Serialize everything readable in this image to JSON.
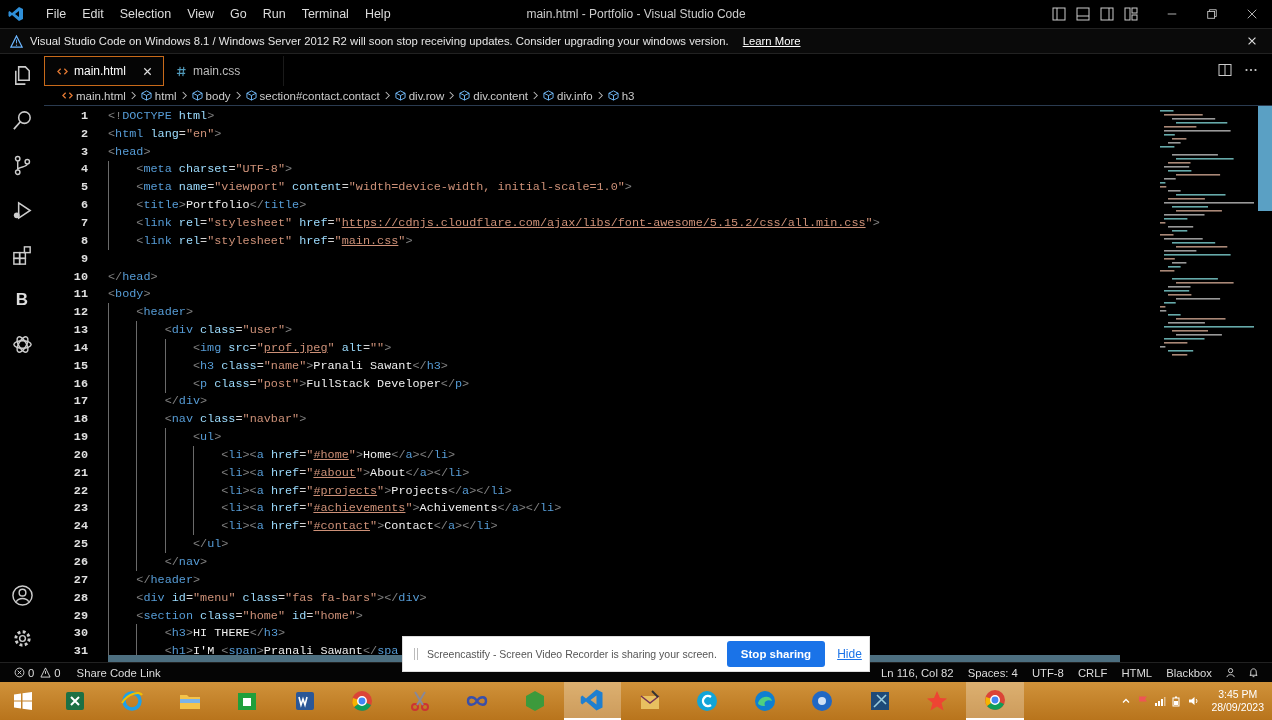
{
  "window": {
    "title": "main.html - Portfolio - Visual Studio Code"
  },
  "menu": [
    "File",
    "Edit",
    "Selection",
    "View",
    "Go",
    "Run",
    "Terminal",
    "Help"
  ],
  "banner": {
    "message": "Visual Studio Code on Windows 8.1 / Windows Server 2012 R2 will soon stop receiving updates. Consider upgrading your windows version.",
    "link": "Learn More"
  },
  "activity_bar": [
    {
      "kind": "explorer"
    },
    {
      "kind": "search"
    },
    {
      "kind": "source-control"
    },
    {
      "kind": "run"
    },
    {
      "kind": "extensions"
    },
    {
      "kind": "letter",
      "label": "B"
    },
    {
      "kind": "knot"
    }
  ],
  "activity_bar_bottom": [
    {
      "kind": "account"
    },
    {
      "kind": "settings"
    }
  ],
  "tabs": [
    {
      "label": "main.html",
      "kind": "html",
      "selected": true
    },
    {
      "label": "main.css",
      "kind": "css",
      "selected": false
    }
  ],
  "breadcrumb": [
    {
      "label": "main.html",
      "kind": "file"
    },
    {
      "label": "html",
      "kind": "element"
    },
    {
      "label": "body",
      "kind": "element"
    },
    {
      "label": "section#contact.contact",
      "kind": "element"
    },
    {
      "label": "div.row",
      "kind": "element"
    },
    {
      "label": "div.content",
      "kind": "element"
    },
    {
      "label": "div.info",
      "kind": "element"
    },
    {
      "label": "h3",
      "kind": "element"
    }
  ],
  "lines": [
    {
      "number": "1",
      "tokens": [
        {
          "kind": "punct",
          "text": "<!"
        },
        {
          "kind": "tag",
          "text": "DOCTYPE"
        },
        {
          "kind": "attr",
          "text": " html"
        },
        {
          "kind": "punct",
          "text": ">"
        }
      ]
    },
    {
      "number": "2",
      "tokens": [
        {
          "kind": "punct",
          "text": "<"
        },
        {
          "kind": "tag",
          "text": "html"
        },
        {
          "kind": "attr",
          "text": " lang"
        },
        {
          "kind": "eq",
          "text": "="
        },
        {
          "kind": "str",
          "text": "\"en\""
        },
        {
          "kind": "punct",
          "text": ">"
        }
      ]
    },
    {
      "number": "3",
      "tokens": [
        {
          "kind": "punct",
          "text": "<"
        },
        {
          "kind": "tag",
          "text": "head"
        },
        {
          "kind": "punct",
          "text": ">"
        }
      ]
    },
    {
      "number": "4",
      "tokens": [
        {
          "kind": "punct",
          "text": "    <"
        },
        {
          "kind": "tag",
          "text": "meta"
        },
        {
          "kind": "attr",
          "text": " charset"
        },
        {
          "kind": "eq",
          "text": "="
        },
        {
          "kind": "str",
          "text": "\"UTF-8\""
        },
        {
          "kind": "punct",
          "text": ">"
        }
      ]
    },
    {
      "number": "5",
      "tokens": [
        {
          "kind": "punct",
          "text": "    <"
        },
        {
          "kind": "tag",
          "text": "meta"
        },
        {
          "kind": "attr",
          "text": " name"
        },
        {
          "kind": "eq",
          "text": "="
        },
        {
          "kind": "str",
          "text": "\"viewport\""
        },
        {
          "kind": "attr",
          "text": " content"
        },
        {
          "kind": "eq",
          "text": "="
        },
        {
          "kind": "str",
          "text": "\"width=device-width, initial-scale=1.0\""
        },
        {
          "kind": "punct",
          "text": ">"
        }
      ]
    },
    {
      "number": "6",
      "tokens": [
        {
          "kind": "punct",
          "text": "    <"
        },
        {
          "kind": "tag",
          "text": "title"
        },
        {
          "kind": "punct",
          "text": ">"
        },
        {
          "kind": "text",
          "text": "Portfolio"
        },
        {
          "kind": "punct",
          "text": "</"
        },
        {
          "kind": "tag",
          "text": "title"
        },
        {
          "kind": "punct",
          "text": ">"
        }
      ]
    },
    {
      "number": "7",
      "tokens": [
        {
          "kind": "punct",
          "text": "    <"
        },
        {
          "kind": "tag",
          "text": "link"
        },
        {
          "kind": "attr",
          "text": " rel"
        },
        {
          "kind": "eq",
          "text": "="
        },
        {
          "kind": "str",
          "text": "\"stylesheet\""
        },
        {
          "kind": "attr",
          "text": " href"
        },
        {
          "kind": "eq",
          "text": "="
        },
        {
          "kind": "str",
          "text": "\""
        },
        {
          "kind": "link",
          "text": "https://cdnjs.cloudflare.com/ajax/libs/font-awesome/5.15.2/css/all.min.css"
        },
        {
          "kind": "str",
          "text": "\""
        },
        {
          "kind": "punct",
          "text": ">"
        }
      ]
    },
    {
      "number": "8",
      "tokens": [
        {
          "kind": "punct",
          "text": "    <"
        },
        {
          "kind": "tag",
          "text": "link"
        },
        {
          "kind": "attr",
          "text": " rel"
        },
        {
          "kind": "eq",
          "text": "="
        },
        {
          "kind": "str",
          "text": "\"stylesheet\""
        },
        {
          "kind": "attr",
          "text": " href"
        },
        {
          "kind": "eq",
          "text": "="
        },
        {
          "kind": "str",
          "text": "\""
        },
        {
          "kind": "link",
          "text": "main.css"
        },
        {
          "kind": "str",
          "text": "\""
        },
        {
          "kind": "punct",
          "text": ">"
        }
      ]
    },
    {
      "number": "9"
    },
    {
      "number": "10",
      "tokens": [
        {
          "kind": "punct",
          "text": "</"
        },
        {
          "kind": "tag",
          "text": "head"
        },
        {
          "kind": "punct",
          "text": ">"
        }
      ]
    },
    {
      "number": "11",
      "tokens": [
        {
          "kind": "punct",
          "text": "<"
        },
        {
          "kind": "tag",
          "text": "body"
        },
        {
          "kind": "punct",
          "text": ">"
        }
      ]
    },
    {
      "number": "12",
      "tokens": [
        {
          "kind": "punct",
          "text": "    <"
        },
        {
          "kind": "tag",
          "text": "header"
        },
        {
          "kind": "punct",
          "text": ">"
        }
      ]
    },
    {
      "number": "13",
      "tokens": [
        {
          "kind": "punct",
          "text": "        <"
        },
        {
          "kind": "tag",
          "text": "div"
        },
        {
          "kind": "attr",
          "text": " class"
        },
        {
          "kind": "eq",
          "text": "="
        },
        {
          "kind": "str",
          "text": "\"user\""
        },
        {
          "kind": "punct",
          "text": ">"
        }
      ]
    },
    {
      "number": "14",
      "tokens": [
        {
          "kind": "punct",
          "text": "            <"
        },
        {
          "kind": "tag",
          "text": "img"
        },
        {
          "kind": "attr",
          "text": " src"
        },
        {
          "kind": "eq",
          "text": "="
        },
        {
          "kind": "str",
          "text": "\""
        },
        {
          "kind": "link",
          "text": "prof.jpeg"
        },
        {
          "kind": "str",
          "text": "\""
        },
        {
          "kind": "attr",
          "text": " alt"
        },
        {
          "kind": "eq",
          "text": "="
        },
        {
          "kind": "str",
          "text": "\"\""
        },
        {
          "kind": "punct",
          "text": ">"
        }
      ]
    },
    {
      "number": "15",
      "tokens": [
        {
          "kind": "punct",
          "text": "            <"
        },
        {
          "kind": "tag",
          "text": "h3"
        },
        {
          "kind": "attr",
          "text": " class"
        },
        {
          "kind": "eq",
          "text": "="
        },
        {
          "kind": "str",
          "text": "\"name\""
        },
        {
          "kind": "punct",
          "text": ">"
        },
        {
          "kind": "text",
          "text": "Pranali Sawant"
        },
        {
          "kind": "punct",
          "text": "</"
        },
        {
          "kind": "tag",
          "text": "h3"
        },
        {
          "kind": "punct",
          "text": ">"
        }
      ]
    },
    {
      "number": "16",
      "tokens": [
        {
          "kind": "punct",
          "text": "            <"
        },
        {
          "kind": "tag",
          "text": "p"
        },
        {
          "kind": "attr",
          "text": " class"
        },
        {
          "kind": "eq",
          "text": "="
        },
        {
          "kind": "str",
          "text": "\"post\""
        },
        {
          "kind": "punct",
          "text": ">"
        },
        {
          "kind": "text",
          "text": "FullStack Developer"
        },
        {
          "kind": "punct",
          "text": "</"
        },
        {
          "kind": "tag",
          "text": "p"
        },
        {
          "kind": "punct",
          "text": ">"
        }
      ]
    },
    {
      "number": "17",
      "tokens": [
        {
          "kind": "punct",
          "text": "        </"
        },
        {
          "kind": "tag",
          "text": "div"
        },
        {
          "kind": "punct",
          "text": ">"
        }
      ]
    },
    {
      "number": "18",
      "tokens": [
        {
          "kind": "punct",
          "text": "        <"
        },
        {
          "kind": "tag",
          "text": "nav"
        },
        {
          "kind": "attr",
          "text": " class"
        },
        {
          "kind": "eq",
          "text": "="
        },
        {
          "kind": "str",
          "text": "\"navbar\""
        },
        {
          "kind": "punct",
          "text": ">"
        }
      ]
    },
    {
      "number": "19",
      "tokens": [
        {
          "kind": "punct",
          "text": "            <"
        },
        {
          "kind": "tag",
          "text": "ul"
        },
        {
          "kind": "punct",
          "text": ">"
        }
      ]
    },
    {
      "number": "20",
      "tokens": [
        {
          "kind": "punct",
          "text": "                <"
        },
        {
          "kind": "tag",
          "text": "li"
        },
        {
          "kind": "punct",
          "text": "><"
        },
        {
          "kind": "tag",
          "text": "a"
        },
        {
          "kind": "attr",
          "text": " href"
        },
        {
          "kind": "eq",
          "text": "="
        },
        {
          "kind": "str",
          "text": "\""
        },
        {
          "kind": "link",
          "text": "#home"
        },
        {
          "kind": "str",
          "text": "\""
        },
        {
          "kind": "punct",
          "text": ">"
        },
        {
          "kind": "text",
          "text": "Home"
        },
        {
          "kind": "punct",
          "text": "</"
        },
        {
          "kind": "tag",
          "text": "a"
        },
        {
          "kind": "punct",
          "text": "></"
        },
        {
          "kind": "tag",
          "text": "li"
        },
        {
          "kind": "punct",
          "text": ">"
        }
      ]
    },
    {
      "number": "21",
      "tokens": [
        {
          "kind": "punct",
          "text": "                <"
        },
        {
          "kind": "tag",
          "text": "li"
        },
        {
          "kind": "punct",
          "text": "><"
        },
        {
          "kind": "tag",
          "text": "a"
        },
        {
          "kind": "attr",
          "text": " href"
        },
        {
          "kind": "eq",
          "text": "="
        },
        {
          "kind": "str",
          "text": "\""
        },
        {
          "kind": "link",
          "text": "#about"
        },
        {
          "kind": "str",
          "text": "\""
        },
        {
          "kind": "punct",
          "text": ">"
        },
        {
          "kind": "text",
          "text": "About"
        },
        {
          "kind": "punct",
          "text": "</"
        },
        {
          "kind": "tag",
          "text": "a"
        },
        {
          "kind": "punct",
          "text": "></"
        },
        {
          "kind": "tag",
          "text": "li"
        },
        {
          "kind": "punct",
          "text": ">"
        }
      ]
    },
    {
      "number": "22",
      "tokens": [
        {
          "kind": "punct",
          "text": "                <"
        },
        {
          "kind": "tag",
          "text": "li"
        },
        {
          "kind": "punct",
          "text": "><"
        },
        {
          "kind": "tag",
          "text": "a"
        },
        {
          "kind": "attr",
          "text": " href"
        },
        {
          "kind": "eq",
          "text": "="
        },
        {
          "kind": "str",
          "text": "\""
        },
        {
          "kind": "link",
          "text": "#projects"
        },
        {
          "kind": "str",
          "text": "\""
        },
        {
          "kind": "punct",
          "text": ">"
        },
        {
          "kind": "text",
          "text": "Projects"
        },
        {
          "kind": "punct",
          "text": "</"
        },
        {
          "kind": "tag",
          "text": "a"
        },
        {
          "kind": "punct",
          "text": "></"
        },
        {
          "kind": "tag",
          "text": "li"
        },
        {
          "kind": "punct",
          "text": ">"
        }
      ]
    },
    {
      "number": "23",
      "tokens": [
        {
          "kind": "punct",
          "text": "                <"
        },
        {
          "kind": "tag",
          "text": "li"
        },
        {
          "kind": "punct",
          "text": "><"
        },
        {
          "kind": "tag",
          "text": "a"
        },
        {
          "kind": "attr",
          "text": " href"
        },
        {
          "kind": "eq",
          "text": "="
        },
        {
          "kind": "str",
          "text": "\""
        },
        {
          "kind": "link",
          "text": "#achievements"
        },
        {
          "kind": "str",
          "text": "\""
        },
        {
          "kind": "punct",
          "text": ">"
        },
        {
          "kind": "text",
          "text": "Achivements"
        },
        {
          "kind": "punct",
          "text": "</"
        },
        {
          "kind": "tag",
          "text": "a"
        },
        {
          "kind": "punct",
          "text": "></"
        },
        {
          "kind": "tag",
          "text": "li"
        },
        {
          "kind": "punct",
          "text": ">"
        }
      ]
    },
    {
      "number": "24",
      "tokens": [
        {
          "kind": "punct",
          "text": "                <"
        },
        {
          "kind": "tag",
          "text": "li"
        },
        {
          "kind": "punct",
          "text": "><"
        },
        {
          "kind": "tag",
          "text": "a"
        },
        {
          "kind": "attr",
          "text": " href"
        },
        {
          "kind": "eq",
          "text": "="
        },
        {
          "kind": "str",
          "text": "\""
        },
        {
          "kind": "link",
          "text": "#contact"
        },
        {
          "kind": "str",
          "text": "\""
        },
        {
          "kind": "punct",
          "text": ">"
        },
        {
          "kind": "text",
          "text": "Contact"
        },
        {
          "kind": "punct",
          "text": "</"
        },
        {
          "kind": "tag",
          "text": "a"
        },
        {
          "kind": "punct",
          "text": "></"
        },
        {
          "kind": "tag",
          "text": "li"
        },
        {
          "kind": "punct",
          "text": ">"
        }
      ]
    },
    {
      "number": "25",
      "tokens": [
        {
          "kind": "punct",
          "text": "            </"
        },
        {
          "kind": "tag",
          "text": "ul"
        },
        {
          "kind": "punct",
          "text": ">"
        }
      ]
    },
    {
      "number": "26",
      "tokens": [
        {
          "kind": "punct",
          "text": "        </"
        },
        {
          "kind": "tag",
          "text": "nav"
        },
        {
          "kind": "punct",
          "text": ">"
        }
      ]
    },
    {
      "number": "27",
      "tokens": [
        {
          "kind": "punct",
          "text": "    </"
        },
        {
          "kind": "tag",
          "text": "header"
        },
        {
          "kind": "punct",
          "text": ">"
        }
      ]
    },
    {
      "number": "28",
      "tokens": [
        {
          "kind": "punct",
          "text": "    <"
        },
        {
          "kind": "tag",
          "text": "div"
        },
        {
          "kind": "attr",
          "text": " id"
        },
        {
          "kind": "eq",
          "text": "="
        },
        {
          "kind": "str",
          "text": "\"menu\""
        },
        {
          "kind": "attr",
          "text": " class"
        },
        {
          "kind": "eq",
          "text": "="
        },
        {
          "kind": "str",
          "text": "\"fas fa-bars\""
        },
        {
          "kind": "punct",
          "text": "></"
        },
        {
          "kind": "tag",
          "text": "div"
        },
        {
          "kind": "punct",
          "text": ">"
        }
      ]
    },
    {
      "number": "29",
      "tokens": [
        {
          "kind": "punct",
          "text": "    <"
        },
        {
          "kind": "tag",
          "text": "section"
        },
        {
          "kind": "attr",
          "text": " class"
        },
        {
          "kind": "eq",
          "text": "="
        },
        {
          "kind": "str",
          "text": "\"home\""
        },
        {
          "kind": "attr",
          "text": " id"
        },
        {
          "kind": "eq",
          "text": "="
        },
        {
          "kind": "str",
          "text": "\"home\""
        },
        {
          "kind": "punct",
          "text": ">"
        }
      ]
    },
    {
      "number": "30",
      "tokens": [
        {
          "kind": "punct",
          "text": "        <"
        },
        {
          "kind": "tag",
          "text": "h3"
        },
        {
          "kind": "punct",
          "text": ">"
        },
        {
          "kind": "text",
          "text": "HI THERE"
        },
        {
          "kind": "punct",
          "text": "</"
        },
        {
          "kind": "tag",
          "text": "h3"
        },
        {
          "kind": "punct",
          "text": ">"
        }
      ]
    },
    {
      "number": "31",
      "tokens": [
        {
          "kind": "punct",
          "text": "        <"
        },
        {
          "kind": "tag",
          "text": "h1"
        },
        {
          "kind": "punct",
          "text": ">"
        },
        {
          "kind": "text",
          "text": "I'M "
        },
        {
          "kind": "punct",
          "text": "<"
        },
        {
          "kind": "tag",
          "text": "span"
        },
        {
          "kind": "punct",
          "text": ">"
        },
        {
          "kind": "text",
          "text": "Pranali Sawant"
        },
        {
          "kind": "punct",
          "text": "</"
        },
        {
          "kind": "tag",
          "text": "spa"
        }
      ]
    }
  ],
  "status_bar": {
    "errors": "0",
    "warnings": "0",
    "share": "Share Code Link",
    "right": [
      "Ln 116, Col 82",
      "Spaces: 4",
      "UTF-8",
      "CRLF",
      "HTML",
      "Blackbox"
    ]
  },
  "notification": {
    "message": "Screencastify - Screen Video Recorder is sharing your screen.",
    "button": "Stop sharing",
    "link": "Hide"
  },
  "taskbar": {
    "apps": [
      {
        "kind": "sheet",
        "selected": false
      },
      {
        "kind": "globe",
        "selected": false
      },
      {
        "kind": "folder",
        "selected": false
      },
      {
        "kind": "store",
        "selected": false
      },
      {
        "kind": "doc",
        "selected": false
      },
      {
        "kind": "browser",
        "selected": false
      },
      {
        "kind": "scissors",
        "selected": false
      },
      {
        "kind": "infinity",
        "selected": false
      },
      {
        "kind": "gem",
        "selected": false
      },
      {
        "kind": "editor",
        "selected": true
      },
      {
        "kind": "mail",
        "selected": false
      },
      {
        "kind": "ring",
        "selected": false
      },
      {
        "kind": "wave",
        "selected": false
      },
      {
        "kind": "disc",
        "selected": false
      },
      {
        "kind": "tool",
        "selected": false
      },
      {
        "kind": "star",
        "selected": false
      },
      {
        "kind": "browser",
        "selected": true
      }
    ],
    "time": "3:45 PM",
    "date": "28/09/2023"
  }
}
